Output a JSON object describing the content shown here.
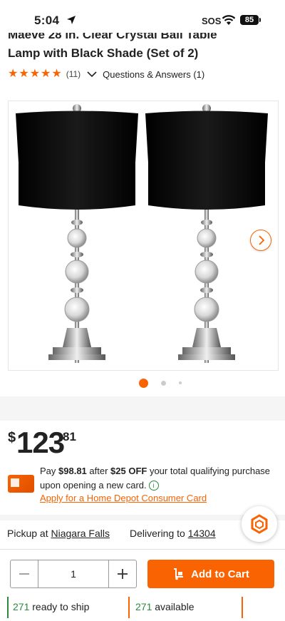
{
  "status_bar": {
    "time": "5:04",
    "sos": "SOS",
    "battery": "85"
  },
  "product": {
    "title_line1": "Maeve 28 in. Clear Crystal Ball Table",
    "title_line2": "Lamp with Black Shade (Set of 2)",
    "rating": 5,
    "review_count": "(11)",
    "qa_label": "Questions & Answers (1)"
  },
  "gallery": {
    "image_count": 3,
    "current_index": 1,
    "next_icon": "chevron-right-icon"
  },
  "price": {
    "currency": "$",
    "dollars": "123",
    "cents": "81"
  },
  "promo": {
    "pay_text": "Pay ",
    "pay_amount": "$98.81",
    "after_text": " after ",
    "off_amount": "$25 OFF",
    "rest_text": " your total qualifying purchase upon opening a new card.",
    "apply_link": "Apply for a Home Depot Consumer Card"
  },
  "fulfillment": {
    "pickup_label": "Pickup at ",
    "pickup_store": "Niagara Falls",
    "delivery_label": "Delivering to ",
    "delivery_zip": "14304"
  },
  "cart": {
    "quantity": "1",
    "add_to_cart": "Add to Cart"
  },
  "availability": {
    "ship_count": "271",
    "ship_text": " ready to ship",
    "avail_count": "271",
    "avail_text": " available"
  },
  "colors": {
    "accent": "#f96302",
    "green": "#2a8a3e"
  }
}
